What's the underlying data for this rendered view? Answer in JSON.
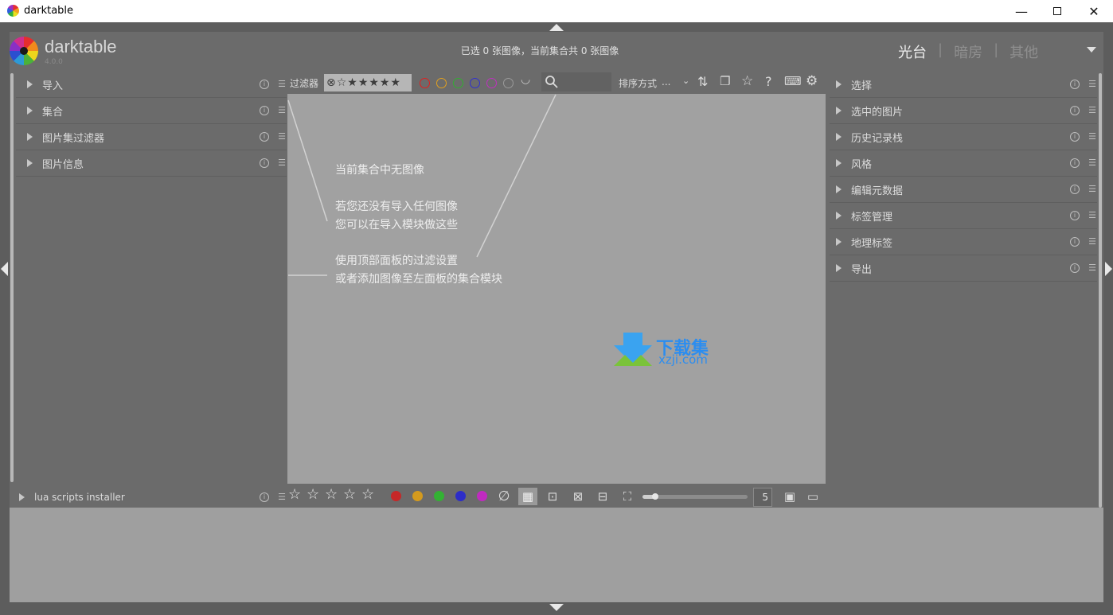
{
  "window": {
    "title": "darktable",
    "minimize_icon": "minimize-icon",
    "maximize_icon": "maximize-icon",
    "close_icon": "close-icon"
  },
  "header": {
    "app_name": "darktable",
    "version": "4.0.0",
    "status": "已选 0 张图像，当前集合共 0 张图像",
    "views": [
      "光台",
      "暗房",
      "其他"
    ],
    "active_view": "光台"
  },
  "left_panel": {
    "modules": [
      {
        "label": "导入"
      },
      {
        "label": "集合"
      },
      {
        "label": "图片集过滤器"
      },
      {
        "label": "图片信息"
      }
    ],
    "bottom_module": "lua scripts installer"
  },
  "top_toolbar": {
    "filter_label": "过滤器",
    "stars_filter": "⊗☆★★★★★",
    "color_labels": [
      "#e02020",
      "#e0a020",
      "#30b030",
      "#3030d0",
      "#c030c0",
      "#9a9a9a"
    ],
    "sort_label": "排序方式",
    "sort_value": "...",
    "icons": [
      "search-icon",
      "sort-order-icon",
      "grouping-icon",
      "overlay-star-icon",
      "help-icon",
      "keyboard-icon",
      "gear-icon"
    ]
  },
  "center": {
    "hint_title": "当前集合中无图像",
    "hint_line1": "若您还没有导入任何图像",
    "hint_line2": "您可以在导入模块做这些",
    "hint_line3": "使用顶部面板的过滤设置",
    "hint_line4": "或者添加图像至左面板的集合模块"
  },
  "bottom_toolbar": {
    "stars": [
      "☆",
      "☆",
      "☆",
      "☆",
      "☆"
    ],
    "color_labels": [
      "#c62828",
      "#d49a1e",
      "#33b233",
      "#2d2dc8",
      "#c02bc0"
    ],
    "zoom_value": "5",
    "zoom_fraction": 0.12
  },
  "right_panel": {
    "modules": [
      {
        "label": "选择"
      },
      {
        "label": "选中的图片"
      },
      {
        "label": "历史记录栈"
      },
      {
        "label": "风格"
      },
      {
        "label": "编辑元数据"
      },
      {
        "label": "标签管理"
      },
      {
        "label": "地理标签"
      },
      {
        "label": "导出"
      }
    ]
  },
  "watermark": {
    "text": "下载集",
    "sub": "xzji.com",
    "color": "#2b8df0"
  }
}
